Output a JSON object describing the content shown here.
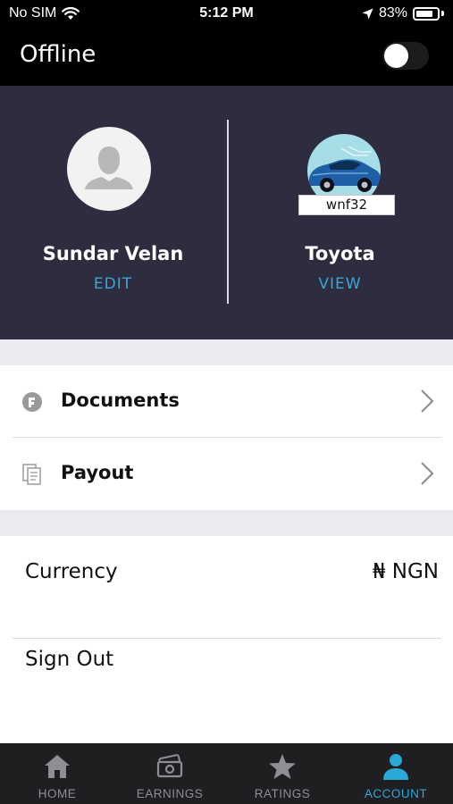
{
  "status_bar": {
    "carrier": "No SIM",
    "time": "5:12 PM",
    "battery": "83%",
    "battery_level": 0.83
  },
  "header": {
    "title": "Offline",
    "online_toggle_on": false
  },
  "profile": {
    "driver_name": "Sundar Velan",
    "edit_label": "EDIT",
    "vehicle_name": "Toyota",
    "plate": "wnf32",
    "view_label": "VIEW"
  },
  "menu": {
    "items": [
      {
        "label": "Documents",
        "icon": "document-icon"
      },
      {
        "label": "Payout",
        "icon": "payout-icon"
      }
    ]
  },
  "settings": {
    "currency_label": "Currency",
    "currency_value": "₦ NGN",
    "sign_out_label": "Sign Out"
  },
  "bottom_nav": {
    "items": [
      {
        "label": "HOME",
        "icon": "home-icon"
      },
      {
        "label": "EARNINGS",
        "icon": "earnings-icon"
      },
      {
        "label": "RATINGS",
        "icon": "star-icon"
      },
      {
        "label": "ACCOUNT",
        "icon": "account-icon"
      }
    ],
    "active_index": 3
  },
  "colors": {
    "accent": "#29a9d8",
    "panel_bg": "#2d2d3f",
    "header_bg": "#000000",
    "nav_bg": "#1f1f21"
  }
}
